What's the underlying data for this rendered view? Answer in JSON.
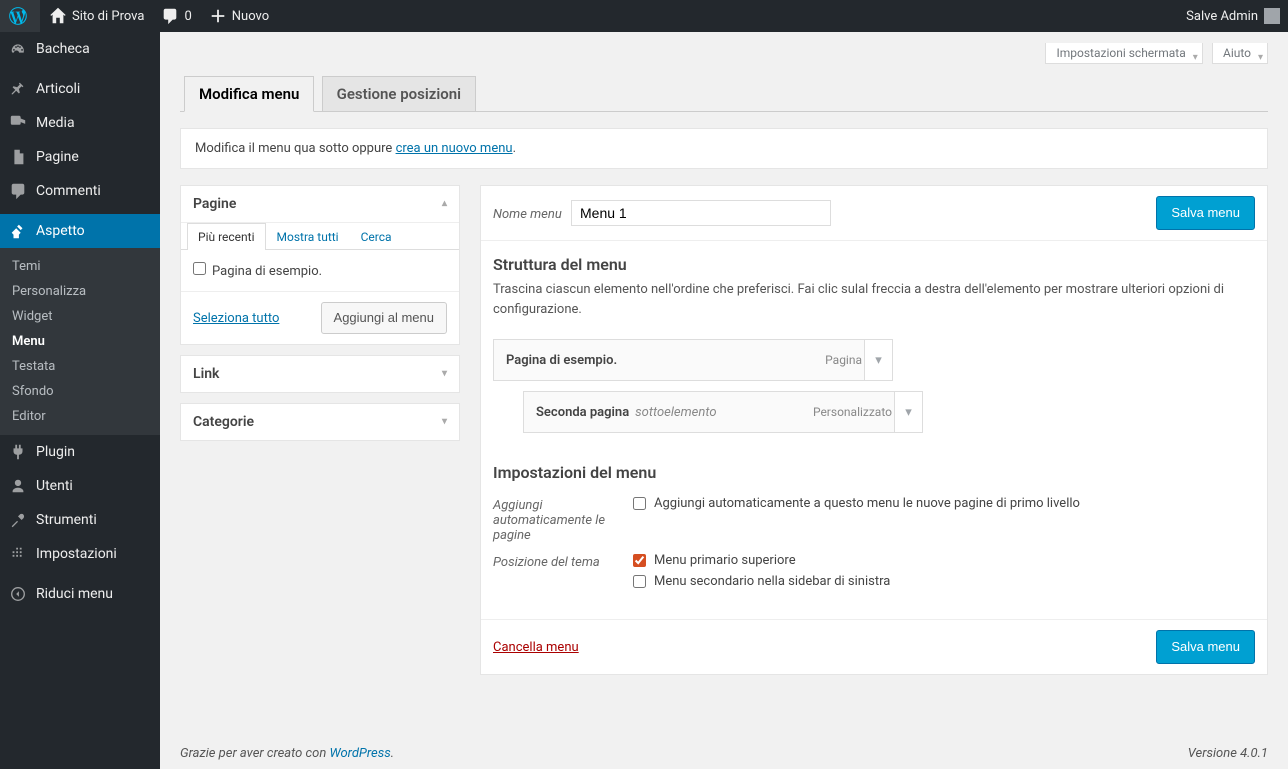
{
  "toolbar": {
    "site_name": "Sito di Prova",
    "comments_count": "0",
    "new_label": "Nuovo",
    "howdy": "Salve Admin"
  },
  "adminmenu": {
    "dashboard": "Bacheca",
    "posts": "Articoli",
    "media": "Media",
    "pages": "Pagine",
    "comments": "Commenti",
    "appearance": "Aspetto",
    "appearance_sub": {
      "themes": "Temi",
      "customize": "Personalizza",
      "widgets": "Widget",
      "menus": "Menu",
      "header": "Testata",
      "background": "Sfondo",
      "editor": "Editor"
    },
    "plugins": "Plugin",
    "users": "Utenti",
    "tools": "Strumenti",
    "settings": "Impostazioni",
    "collapse": "Riduci menu"
  },
  "screen_options": "Impostazioni schermata",
  "help": "Aiuto",
  "tabs": {
    "edit": "Modifica menu",
    "locations": "Gestione posizioni"
  },
  "manage": {
    "prefix": "Modifica il menu qua sotto oppure ",
    "link": "crea un nuovo menu",
    "suffix": "."
  },
  "accordions": {
    "pages": {
      "title": "Pagine",
      "tabs": {
        "recent": "Più recenti",
        "all": "Mostra tutti",
        "search": "Cerca"
      },
      "items": [
        "Pagina di esempio."
      ],
      "select_all": "Seleziona tutto",
      "add_button": "Aggiungi al menu"
    },
    "links": "Link",
    "categories": "Categorie"
  },
  "menu_header": {
    "label": "Nome menu",
    "value": "Menu 1",
    "save": "Salva menu"
  },
  "structure": {
    "title": "Struttura del menu",
    "desc": "Trascina ciascun elemento nell'ordine che preferisci. Fai clic sulal freccia a destra dell'elemento per mostrare ulteriori opzioni di configurazione.",
    "items": [
      {
        "title": "Pagina di esempio.",
        "type": "Pagina",
        "sub": ""
      },
      {
        "title": "Seconda pagina",
        "type": "Personalizzato",
        "sub": "sottoelemento"
      }
    ]
  },
  "settings": {
    "title": "Impostazioni del menu",
    "auto_label": "Aggiungi automaticamente le pagine",
    "auto_check": "Aggiungi automaticamente a questo menu le nuove pagine di primo livello",
    "loc_label": "Posizione del tema",
    "loc1": "Menu primario superiore",
    "loc2": "Menu secondario nella sidebar di sinistra"
  },
  "footer_actions": {
    "delete": "Cancella menu",
    "save": "Salva menu"
  },
  "wpfooter": {
    "thanks_prefix": "Grazie per aver creato con ",
    "wp": "WordPress",
    "thanks_suffix": ".",
    "version": "Versione 4.0.1"
  }
}
